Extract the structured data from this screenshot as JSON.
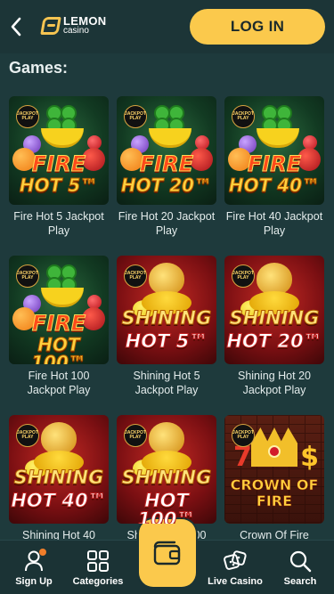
{
  "header": {
    "logo_line1": "LEMON",
    "logo_line2": "casino",
    "login_label": "LOG IN"
  },
  "section": {
    "title": "Games:"
  },
  "games": [
    {
      "title": "Fire Hot 5 Jackpot Play",
      "art_line1": "FIRE",
      "art_line2": "HOT 5™",
      "theme": "fire"
    },
    {
      "title": "Fire Hot 20 Jackpot Play",
      "art_line1": "FIRE",
      "art_line2": "HOT 20™",
      "theme": "fire"
    },
    {
      "title": "Fire Hot 40 Jackpot Play",
      "art_line1": "FIRE",
      "art_line2": "HOT 40™",
      "theme": "fire"
    },
    {
      "title": "Fire Hot 100 Jackpot Play",
      "art_line1": "FIRE",
      "art_line2": "HOT 100™",
      "theme": "fire"
    },
    {
      "title": "Shining Hot 5 Jackpot Play",
      "art_line1": "SHINING",
      "art_line2": "HOT 5™",
      "theme": "shine"
    },
    {
      "title": "Shining Hot 20 Jackpot Play",
      "art_line1": "SHINING",
      "art_line2": "HOT 20™",
      "theme": "shine"
    },
    {
      "title": "Shining Hot 40",
      "art_line1": "SHINING",
      "art_line2": "HOT 40™",
      "theme": "shine"
    },
    {
      "title": "Shining Hot 100",
      "art_line1": "SHINING",
      "art_line2": "HOT 100™",
      "theme": "shine"
    },
    {
      "title": "Crown Of Fire",
      "art_line1": "CROWN OF",
      "art_line2": "FIRE",
      "theme": "crown"
    }
  ],
  "badge": {
    "line1": "JACKPOT",
    "line2": "PLAY"
  },
  "nav": {
    "signup": "Sign Up",
    "categories": "Categories",
    "live_casino": "Live Casino",
    "search": "Search"
  },
  "colors": {
    "accent": "#fbc94c",
    "background": "#1e3a3c",
    "notify": "#f07e2a"
  },
  "icons": [
    "back-arrow-icon",
    "user-icon",
    "categories-grid-icon",
    "wallet-icon",
    "dice-icon",
    "search-icon"
  ]
}
